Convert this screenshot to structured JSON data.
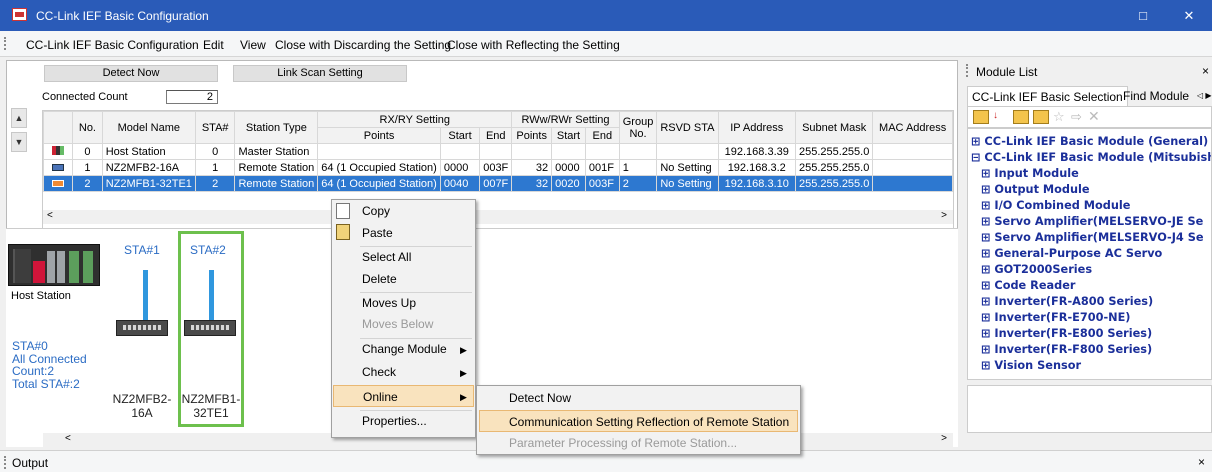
{
  "window": {
    "title": "CC-Link IEF Basic Configuration",
    "minimize": "□",
    "close": "✕"
  },
  "menubar": [
    "CC-Link IEF Basic Configuration",
    "Edit",
    "View",
    "Close with Discarding the Setting",
    "Close with Reflecting the Setting"
  ],
  "toolbar": {
    "detect_now": "Detect Now",
    "link_scan": "Link Scan Setting",
    "connected_label": "Connected Count",
    "connected_value": "2"
  },
  "table": {
    "headers": {
      "no": "No.",
      "model": "Model Name",
      "sta": "STA#",
      "type": "Station Type",
      "rxry": "RX/RY Setting",
      "points": "Points",
      "start": "Start",
      "end": "End",
      "rww": "RWw/RWr Setting",
      "rww_points": "Points",
      "rww_start": "Start",
      "rww_end": "End",
      "group": "Group No.",
      "rsvd": "RSVD STA",
      "ip": "IP Address",
      "subnet": "Subnet Mask",
      "mac": "MAC Address"
    },
    "rows": [
      {
        "no": "0",
        "model": "Host Station",
        "sta": "0",
        "type": "Master Station",
        "points": "",
        "start": "",
        "end": "",
        "rpoints": "",
        "rstart": "",
        "rend": "",
        "group": "",
        "rsvd": "",
        "ip": "192.168.3.39",
        "subnet": "255.255.255.0",
        "mac": ""
      },
      {
        "no": "1",
        "model": "NZ2MFB2-16A",
        "sta": "1",
        "type": "Remote Station",
        "points": "64 (1 Occupied Station)",
        "start": "0000",
        "end": "003F",
        "rpoints": "32",
        "rstart": "0000",
        "rend": "001F",
        "group": "1",
        "rsvd": "No Setting",
        "ip": "192.168.3.2",
        "subnet": "255.255.255.0",
        "mac": ""
      },
      {
        "no": "2",
        "model": "NZ2MFB1-32TE1",
        "sta": "2",
        "type": "Remote Station",
        "points": "64 (1 Occupied Station)",
        "start": "0040",
        "end": "007F",
        "rpoints": "32",
        "rstart": "0020",
        "rend": "003F",
        "group": "2",
        "rsvd": "No Setting",
        "ip": "192.168.3.10",
        "subnet": "255.255.255.0",
        "mac": ""
      }
    ]
  },
  "diagram": {
    "host_label": "Host Station",
    "sta1": "STA#1",
    "sta2": "STA#2",
    "info": "STA#0\nAll Connected\nCount:2\nTotal STA#:2",
    "mod1": "NZ2MFB2-\n16A",
    "mod2": "NZ2MFB1-\n32TE1"
  },
  "context_menu": [
    "Copy",
    "Paste",
    "Select All",
    "Delete",
    "Moves Up",
    "Moves Below",
    "Change Module",
    "Check",
    "Online",
    "Properties..."
  ],
  "submenu": [
    "Detect Now",
    "Communication Setting Reflection of Remote Station",
    "Parameter Processing of Remote Station..."
  ],
  "module_list": {
    "title": "Module List",
    "close": "×",
    "tab_selection": "CC-Link IEF Basic Selection",
    "tab_find": "Find Module",
    "tab_more": "◁ ▶",
    "tree": [
      {
        "text": "⊞ CC-Link IEF Basic Module (General)",
        "indent": 0
      },
      {
        "text": "⊟ CC-Link IEF Basic Module (Mitsubishi",
        "indent": 0
      },
      {
        "text": "⊞ Input Module",
        "indent": 1
      },
      {
        "text": "⊞ Output Module",
        "indent": 1
      },
      {
        "text": "⊞ I/O Combined Module",
        "indent": 1
      },
      {
        "text": "⊞ Servo Amplifier(MELSERVO-JE Se",
        "indent": 1
      },
      {
        "text": "⊞ Servo Amplifier(MELSERVO-J4 Se",
        "indent": 1
      },
      {
        "text": "⊞ General-Purpose AC Servo",
        "indent": 1
      },
      {
        "text": "⊞ GOT2000Series",
        "indent": 1
      },
      {
        "text": "⊞ Code Reader",
        "indent": 1
      },
      {
        "text": "⊞ Inverter(FR-A800 Series)",
        "indent": 1
      },
      {
        "text": "⊞ Inverter(FR-E700-NE)",
        "indent": 1
      },
      {
        "text": "⊞ Inverter(FR-E800 Series)",
        "indent": 1
      },
      {
        "text": "⊞ Inverter(FR-F800 Series)",
        "indent": 1
      },
      {
        "text": "⊞ Vision Sensor",
        "indent": 1
      }
    ]
  },
  "output": {
    "label": "Output",
    "close": "×"
  }
}
